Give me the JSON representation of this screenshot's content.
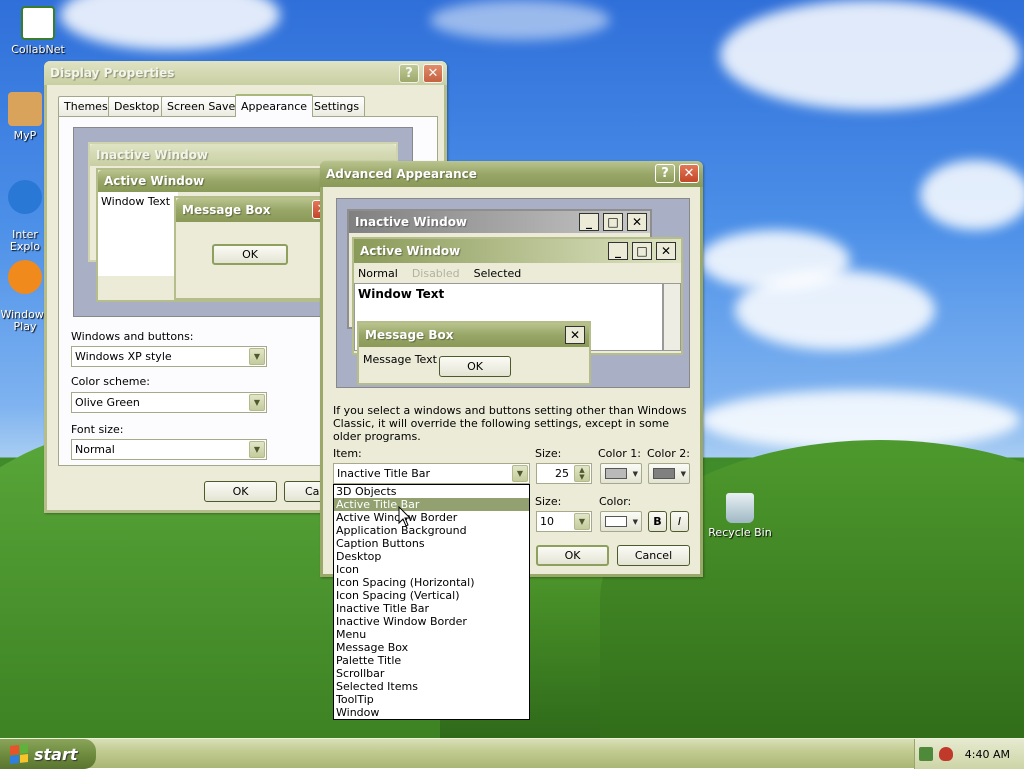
{
  "desktop": {
    "icons": [
      {
        "label": "CollabNet"
      },
      {
        "label": "MyP"
      },
      {
        "label": "Inter\nExplo"
      },
      {
        "label": "Windows\nPlay"
      },
      {
        "label": "Recycle Bin"
      }
    ]
  },
  "display_properties": {
    "title": "Display Properties",
    "tabs": [
      "Themes",
      "Desktop",
      "Screen Saver",
      "Appearance",
      "Settings"
    ],
    "active_tab": "Appearance",
    "preview": {
      "inactive_window": "Inactive Window",
      "active_window": "Active Window",
      "window_text": "Window Text",
      "message_box": "Message Box",
      "ok": "OK"
    },
    "windows_buttons_label": "Windows and buttons:",
    "windows_buttons_value": "Windows XP style",
    "color_scheme_label": "Color scheme:",
    "color_scheme_value": "Olive Green",
    "font_size_label": "Font size:",
    "font_size_value": "Normal",
    "ok": "OK",
    "cancel": "Car"
  },
  "advanced_appearance": {
    "title": "Advanced Appearance",
    "preview": {
      "inactive_window": "Inactive Window",
      "active_window": "Active Window",
      "menu_normal": "Normal",
      "menu_disabled": "Disabled",
      "menu_selected": "Selected",
      "window_text": "Window Text",
      "message_box": "Message Box",
      "message_text": "Message Text",
      "ok": "OK"
    },
    "note": "If you select a windows and buttons setting other than Windows Classic, it will override the following settings, except in some older programs.",
    "item_label": "Item:",
    "item_value": "Inactive Title Bar",
    "size_label": "Size:",
    "size_value": "25",
    "color1_label": "Color 1:",
    "color2_label": "Color 2:",
    "font_size_label": "Size:",
    "font_size_value": "10",
    "font_color_label": "Color:",
    "bold": "B",
    "italic": "I",
    "ok": "OK",
    "cancel": "Cancel",
    "item_options": [
      "3D Objects",
      "Active Title Bar",
      "Active Window Border",
      "Application Background",
      "Caption Buttons",
      "Desktop",
      "Icon",
      "Icon Spacing (Horizontal)",
      "Icon Spacing (Vertical)",
      "Inactive Title Bar",
      "Inactive Window Border",
      "Menu",
      "Message Box",
      "Palette Title",
      "Scrollbar",
      "Selected Items",
      "ToolTip",
      "Window"
    ],
    "highlighted_option": "Active Title Bar",
    "colors": {
      "color1": "#b9b9b9",
      "color2": "#808080",
      "font_color": "#ffffff"
    }
  },
  "taskbar": {
    "start_label": "start",
    "clock": "4:40 AM"
  },
  "theme": {
    "accent": "#8a9a58",
    "face": "#ecebd8",
    "selection": "#93a070"
  }
}
